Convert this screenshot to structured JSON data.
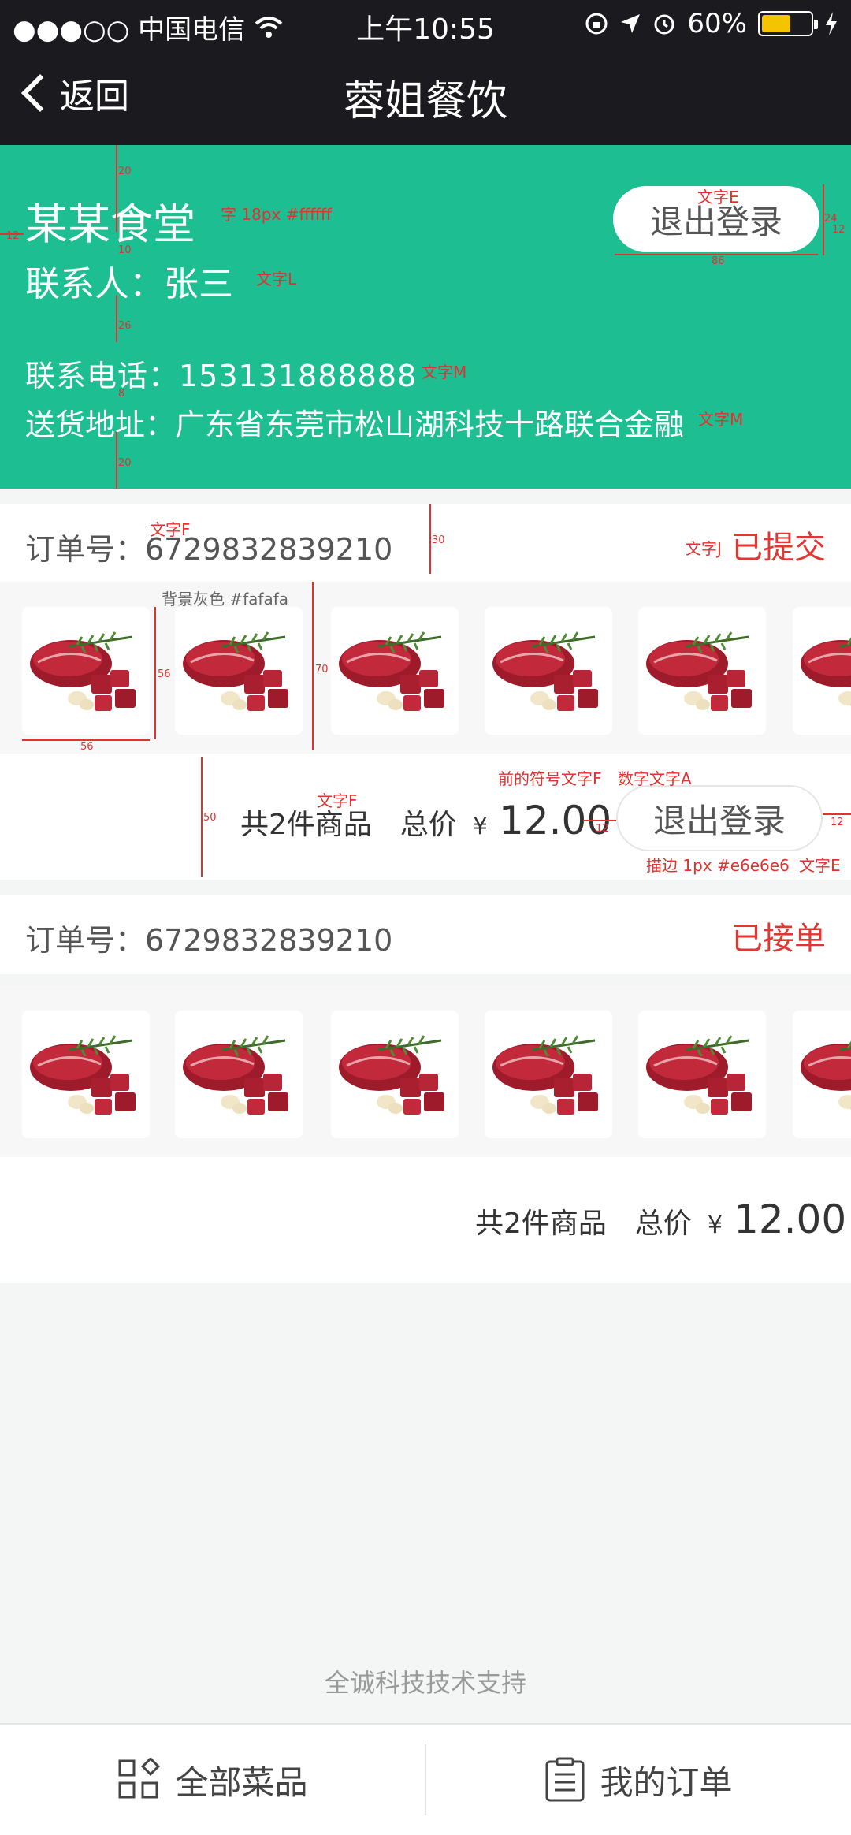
{
  "status_bar": {
    "carrier": "●●●○○ 中国电信",
    "time": "上午10:55",
    "battery": "60%",
    "battery_level": 0.6
  },
  "nav": {
    "back_label": "返回",
    "title": "蓉姐餐饮"
  },
  "hero": {
    "store_name": "某某食堂",
    "contact": "联系人：张三",
    "phone": "联系电话：153131888888",
    "address": "送货地址：广东省东莞市松山湖科技十路联合金融",
    "logout_label": "退出登录",
    "bg_color": "#1dbf92"
  },
  "annotations": {
    "font_note": "字 18px #ffffff",
    "text_e": "文字E",
    "text_l": "文字L",
    "text_m1": "文字M",
    "text_m2": "文字M",
    "text_f": "文字F",
    "text_j": "文字J",
    "bg_gray": "背景灰色 #fafafa",
    "prefix_note": "前的符号文字F",
    "number_note": "数字文字A",
    "text_f2": "文字F",
    "border_note": "描边 1px #e6e6e6",
    "text_e2": "文字E",
    "m20": "20",
    "m12": "12",
    "m10": "10",
    "m26": "26",
    "m8": "8",
    "m20b": "20",
    "m8b": "8",
    "m24": "24",
    "m12b": "12",
    "m86": "86",
    "m30": "30",
    "m56a": "56",
    "m56b": "56",
    "m70": "70",
    "m50": "50",
    "m12c": "12",
    "m12d": "12"
  },
  "orders": [
    {
      "order_no": "订单号：6729832839210",
      "status": "已提交",
      "count_text": "共2件商品",
      "total_label": "总价",
      "currency": "¥",
      "amount": "12.00",
      "button_label": "退出登录"
    },
    {
      "order_no": "订单号：6729832839210",
      "status": "已接单",
      "count_text": "共2件商品",
      "total_label": "总价",
      "currency": "¥",
      "amount": "12.00"
    }
  ],
  "footer": {
    "support": "全诚科技技术支持"
  },
  "tabs": [
    {
      "label": "全部菜品",
      "icon": "grid-icon"
    },
    {
      "label": "我的订单",
      "icon": "order-list-icon"
    }
  ],
  "colors": {
    "accent": "#1dbf92",
    "status_red": "#e23633",
    "annotation_red": "#e0322f"
  }
}
